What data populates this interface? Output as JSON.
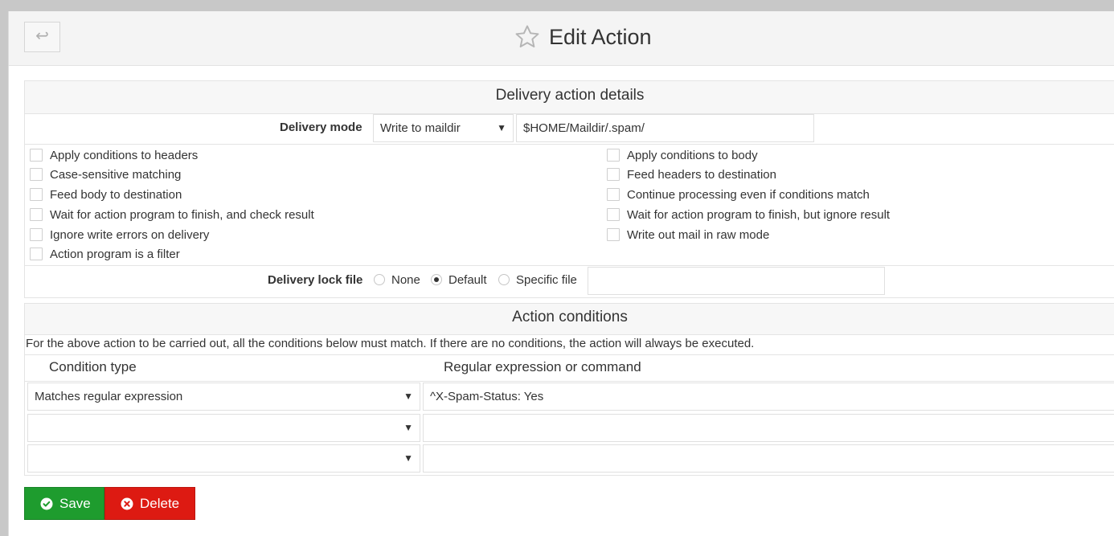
{
  "header": {
    "back_icon": "↩",
    "title": "Edit Action"
  },
  "delivery": {
    "section_title": "Delivery action details",
    "mode_label": "Delivery mode",
    "mode_value": "Write to maildir",
    "mode_path": "$HOME/Maildir/.spam/",
    "options_left": [
      "Apply conditions to headers",
      "Case-sensitive matching",
      "Feed body to destination",
      "Wait for action program to finish, and check result",
      "Ignore write errors on delivery",
      "Action program is a filter"
    ],
    "options_right": [
      "Apply conditions to body",
      "Feed headers to destination",
      "Continue processing even if conditions match",
      "Wait for action program to finish, but ignore result",
      "Write out mail in raw mode"
    ],
    "lock_label": "Delivery lock file",
    "lock_none": "None",
    "lock_default": "Default",
    "lock_specific": "Specific file",
    "lock_selected": "Default",
    "lock_file_value": ""
  },
  "conditions": {
    "section_title": "Action conditions",
    "description": "For the above action to be carried out, all the conditions below must match. If there are no conditions, the action will always be executed.",
    "col_type": "Condition type",
    "col_expr": "Regular expression or command",
    "rows": [
      {
        "type": "Matches regular expression",
        "expr": "^X-Spam-Status: Yes"
      },
      {
        "type": "",
        "expr": ""
      },
      {
        "type": "",
        "expr": ""
      }
    ]
  },
  "buttons": {
    "save": "Save",
    "delete": "Delete"
  },
  "colors": {
    "save": "#1e9c2e",
    "delete": "#dd1a12"
  }
}
